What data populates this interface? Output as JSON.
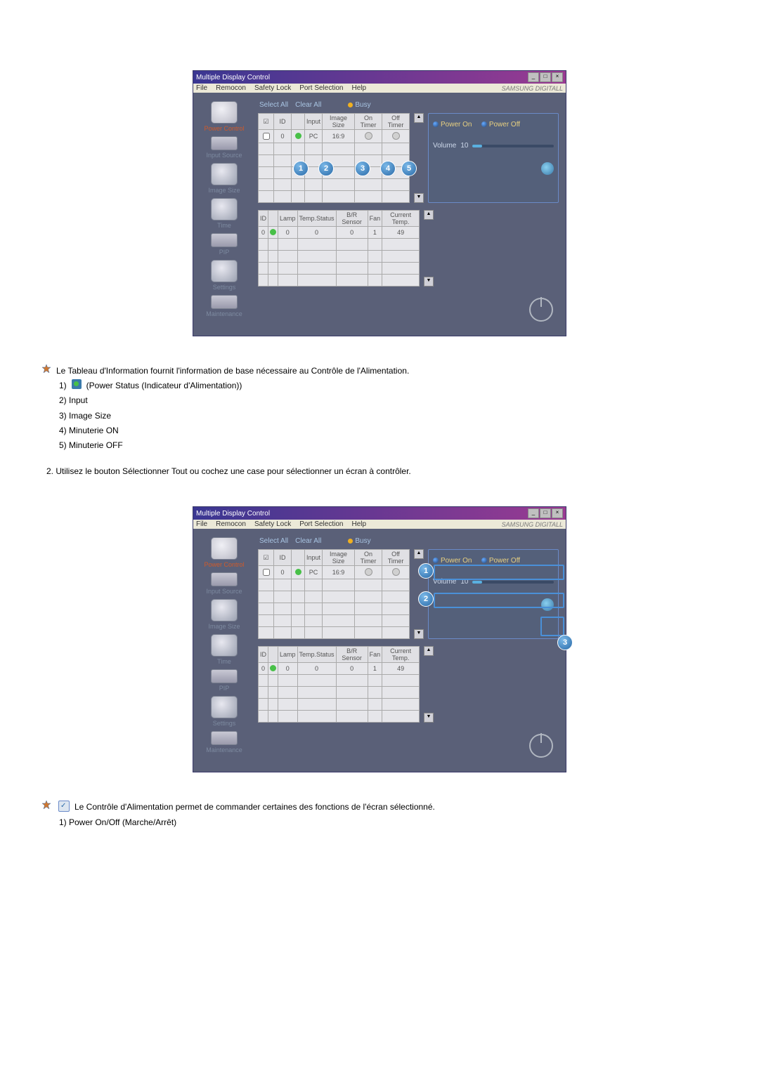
{
  "window": {
    "title": "Multiple Display Control",
    "menu": [
      "File",
      "Remocon",
      "Safety Lock",
      "Port Selection",
      "Help"
    ],
    "brand": "SAMSUNG DIGITALL"
  },
  "sidebar": {
    "items": [
      {
        "label": "Power Control"
      },
      {
        "label": "Input Source"
      },
      {
        "label": "Image Size"
      },
      {
        "label": "Time"
      },
      {
        "label": "PIP"
      },
      {
        "label": "Settings"
      },
      {
        "label": "Maintenance"
      }
    ]
  },
  "toolbar": {
    "select_all": "Select All",
    "clear_all": "Clear All",
    "busy": "Busy"
  },
  "table1": {
    "headers": [
      "",
      "ID",
      "",
      "Input",
      "Image Size",
      "On Timer",
      "Off Timer"
    ],
    "row": {
      "id": "0",
      "input": "PC",
      "image_size": "16:9"
    }
  },
  "table2": {
    "headers": [
      "ID",
      "",
      "Lamp",
      "Temp.Status",
      "B/R Sensor",
      "Fan",
      "Current Temp."
    ],
    "row": {
      "id": "0",
      "lamp": "0",
      "temp_status": "0",
      "br": "0",
      "fan": "1",
      "ctemp": "49"
    }
  },
  "controls": {
    "power_on": "Power On",
    "power_off": "Power Off",
    "volume_label": "Volume",
    "volume_value": "10"
  },
  "annotations1": {
    "c1": "1",
    "c2": "2",
    "c3": "3",
    "c4": "4",
    "c5": "5"
  },
  "annotations2": {
    "c1": "1",
    "c2": "2",
    "c3": "3"
  },
  "desc1": {
    "lead": "Le Tableau d'Information fournit l'information de base nécessaire au Contrôle de l'Alimentation.",
    "l1a": "1)",
    "l1b": "(Power Status (Indicateur d'Alimentation))",
    "l2": "2) Input",
    "l3": "3) Image Size",
    "l4": "4) Minuterie ON",
    "l5": "5) Minuterie OFF",
    "step2": "2.   Utilisez le bouton Sélectionner Tout ou cochez une case pour sélectionner un écran à contrôler."
  },
  "desc2": {
    "lead": "Le Contrôle d'Alimentation permet de commander certaines des fonctions de l'écran sélectionné.",
    "l1": "1) Power On/Off (Marche/Arrêt)"
  }
}
